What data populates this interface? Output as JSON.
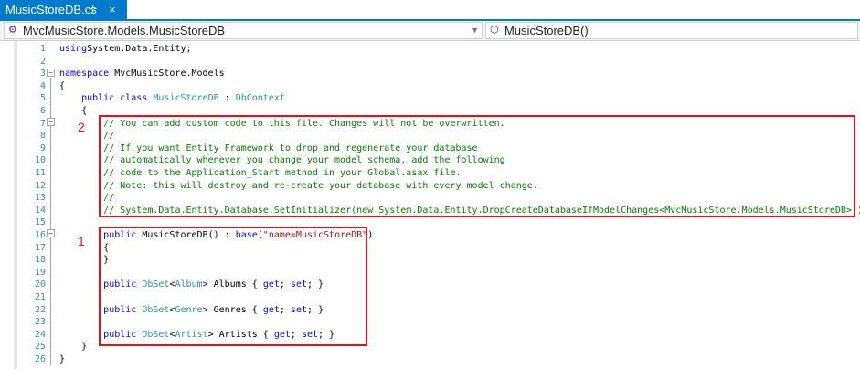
{
  "tab": {
    "title": "MusicStoreDB.cs",
    "pin": "⊹",
    "close": "×"
  },
  "nav": {
    "left": "MvcMusicStore.Models.MusicStoreDB",
    "right": "MusicStoreDB()"
  },
  "markers": {
    "box2": "2",
    "box1": "1"
  },
  "lines": [
    {
      "n": "1",
      "parts": [
        [
          "kw",
          "using"
        ],
        [
          "",
          "System.Data.Entity;"
        ]
      ]
    },
    {
      "n": "2",
      "parts": []
    },
    {
      "n": "3",
      "parts": [
        [
          "kw",
          "namespace"
        ],
        [
          "",
          " MvcMusicStore.Models"
        ]
      ]
    },
    {
      "n": "4",
      "parts": [
        [
          "",
          "{"
        ]
      ]
    },
    {
      "n": "5",
      "parts": [
        [
          "",
          "    "
        ],
        [
          "kw",
          "public class"
        ],
        [
          "",
          " "
        ],
        [
          "ty",
          "MusicStoreDB"
        ],
        [
          "",
          " : "
        ],
        [
          "ty",
          "DbContext"
        ]
      ]
    },
    {
      "n": "6",
      "parts": [
        [
          "",
          "    {"
        ]
      ]
    },
    {
      "n": "7",
      "parts": [
        [
          "",
          "        "
        ],
        [
          "cm",
          "// You can add custom code to this file. Changes will not be overwritten."
        ]
      ]
    },
    {
      "n": "8",
      "parts": [
        [
          "",
          "        "
        ],
        [
          "cm",
          "//"
        ]
      ]
    },
    {
      "n": "9",
      "parts": [
        [
          "",
          "        "
        ],
        [
          "cm",
          "// If you want Entity Framework to drop and regenerate your database"
        ]
      ]
    },
    {
      "n": "10",
      "parts": [
        [
          "",
          "        "
        ],
        [
          "cm",
          "// automatically whenever you change your model schema, add the following"
        ]
      ]
    },
    {
      "n": "11",
      "parts": [
        [
          "",
          "        "
        ],
        [
          "cm",
          "// code to the Application_Start method in your Global.asax file."
        ]
      ]
    },
    {
      "n": "12",
      "parts": [
        [
          "",
          "        "
        ],
        [
          "cm",
          "// Note: this will destroy and re-create your database with every model change."
        ]
      ]
    },
    {
      "n": "13",
      "parts": [
        [
          "",
          "        "
        ],
        [
          "cm",
          "//"
        ]
      ]
    },
    {
      "n": "14",
      "parts": [
        [
          "",
          "        "
        ],
        [
          "cm",
          "// System.Data.Entity.Database.SetInitializer(new System.Data.Entity.DropCreateDatabaseIfModelChanges<MvcMusicStore.Models.MusicStoreDB>());"
        ]
      ]
    },
    {
      "n": "15",
      "parts": []
    },
    {
      "n": "16",
      "parts": [
        [
          "",
          "        "
        ],
        [
          "kw",
          "public"
        ],
        [
          "",
          " MusicStoreDB() : "
        ],
        [
          "kw",
          "base"
        ],
        [
          "",
          "("
        ],
        [
          "st",
          "\"name=MusicStoreDB\""
        ],
        [
          "",
          ")"
        ]
      ]
    },
    {
      "n": "17",
      "parts": [
        [
          "",
          "        {"
        ]
      ]
    },
    {
      "n": "18",
      "parts": [
        [
          "",
          "        }"
        ]
      ]
    },
    {
      "n": "19",
      "parts": []
    },
    {
      "n": "20",
      "parts": [
        [
          "",
          "        "
        ],
        [
          "kw",
          "public"
        ],
        [
          "",
          " "
        ],
        [
          "ty",
          "DbSet"
        ],
        [
          "",
          "<"
        ],
        [
          "ty",
          "Album"
        ],
        [
          "",
          "> Albums { "
        ],
        [
          "kw",
          "get"
        ],
        [
          "",
          "; "
        ],
        [
          "kw",
          "set"
        ],
        [
          "",
          "; }"
        ]
      ]
    },
    {
      "n": "21",
      "parts": []
    },
    {
      "n": "22",
      "parts": [
        [
          "",
          "        "
        ],
        [
          "kw",
          "public"
        ],
        [
          "",
          " "
        ],
        [
          "ty",
          "DbSet"
        ],
        [
          "",
          "<"
        ],
        [
          "ty",
          "Genre"
        ],
        [
          "",
          "> Genres { "
        ],
        [
          "kw",
          "get"
        ],
        [
          "",
          "; "
        ],
        [
          "kw",
          "set"
        ],
        [
          "",
          "; }"
        ]
      ]
    },
    {
      "n": "23",
      "parts": []
    },
    {
      "n": "24",
      "parts": [
        [
          "",
          "        "
        ],
        [
          "kw",
          "public"
        ],
        [
          "",
          " "
        ],
        [
          "ty",
          "DbSet"
        ],
        [
          "",
          "<"
        ],
        [
          "ty",
          "Artist"
        ],
        [
          "",
          "> Artists { "
        ],
        [
          "kw",
          "get"
        ],
        [
          "",
          "; "
        ],
        [
          "kw",
          "set"
        ],
        [
          "",
          "; }"
        ]
      ]
    },
    {
      "n": "25",
      "parts": [
        [
          "",
          "    }"
        ]
      ]
    },
    {
      "n": "26",
      "parts": [
        [
          "",
          "}"
        ]
      ]
    }
  ]
}
